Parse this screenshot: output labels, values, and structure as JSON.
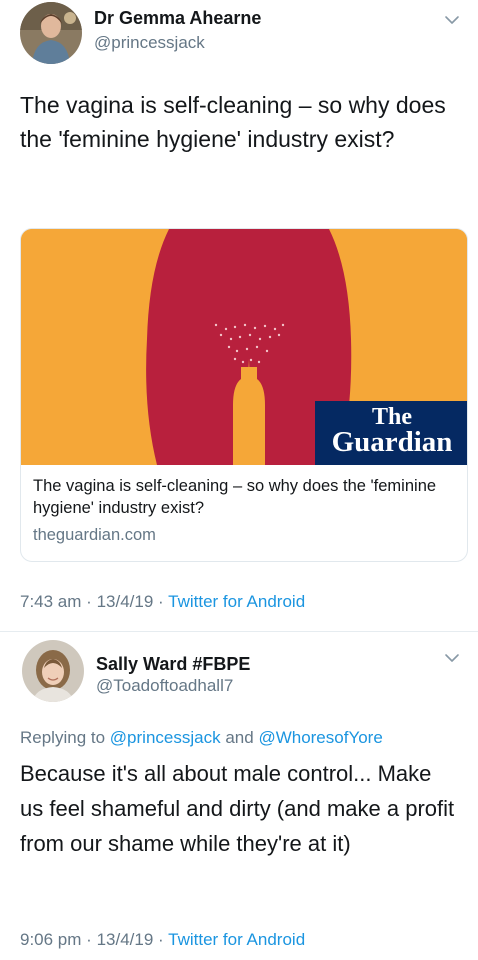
{
  "tweet1": {
    "author_name": "Dr Gemma Ahearne",
    "author_handle": "@princessjack",
    "text": "The vagina is self-cleaning – so why does the 'feminine hygiene' industry exist?",
    "card": {
      "logo_line1": "The",
      "logo_line2": "Guardian",
      "title": "The vagina is self-cleaning – so why does the 'feminine hygiene' industry exist?",
      "domain": "theguardian.com"
    },
    "time": "7:43 am",
    "date": "13/4/19",
    "source": "Twitter for Android"
  },
  "tweet2": {
    "author_name": "Sally Ward #FBPE",
    "author_handle": "@Toadoftoadhall7",
    "replying_prefix": "Replying to",
    "mention1": "@princessjack",
    "replying_and": "and",
    "mention2": "@WhoresofYore",
    "text": "Because it's all about male control... Make us feel shameful and dirty (and make a profit from our shame while they're at it)",
    "time": "9:06 pm",
    "date": "13/4/19",
    "source": "Twitter for Android"
  },
  "meta_separator": "·",
  "colors": {
    "link": "#1b95e0",
    "secondary_text": "#657786",
    "card_background": "#f5a738",
    "figure": "#b8203d",
    "guardian_blue": "#052962"
  },
  "icons": {
    "menu": "chevron-down-icon"
  }
}
